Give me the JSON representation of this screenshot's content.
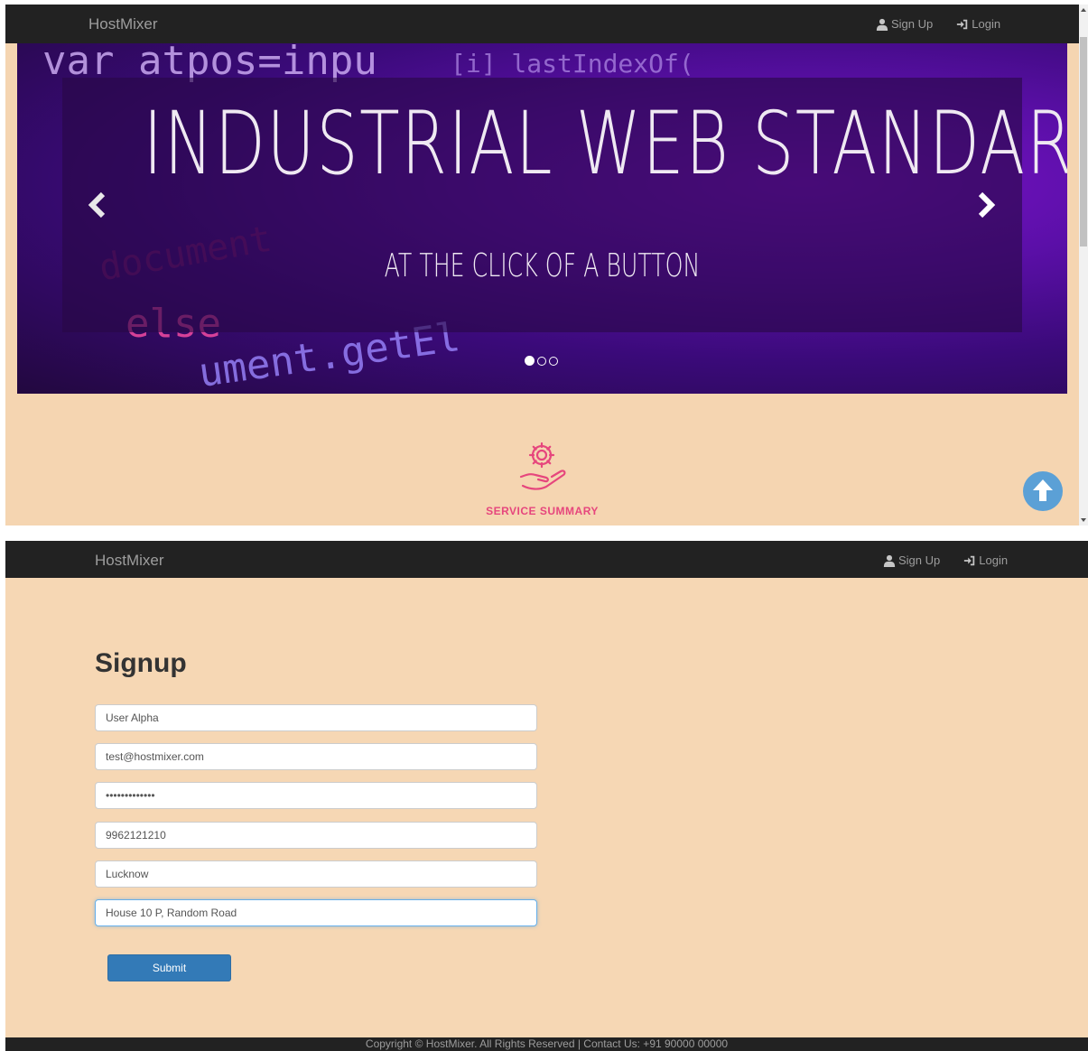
{
  "brand": "HostMixer",
  "nav": {
    "signup": "Sign Up",
    "login": "Login",
    "signup_icon": "user-icon",
    "login_icon": "login-icon"
  },
  "hero": {
    "headline": "INDUSTRIAL WEB STANDARDS",
    "subline": "AT THE CLICK OF A BUTTON",
    "background_code": [
      "var atpos=inpu",
      "[i] lastIndexOf(",
      "else",
      "ument.getEl",
      "document"
    ],
    "slide_count": 3,
    "active_slide": 1
  },
  "service": {
    "label": "SERVICE SUMMARY",
    "icon": "hand-gear-icon"
  },
  "back_to_top_icon": "arrow-up-icon",
  "signup_form": {
    "title": "Signup",
    "fields": [
      {
        "value": "User Alpha"
      },
      {
        "value": "test@hostmixer.com"
      },
      {
        "value": "•••••••••••••"
      },
      {
        "value": "9962121210"
      },
      {
        "value": "Lucknow"
      },
      {
        "value": "House 10 P, Random Road"
      }
    ],
    "submit_label": "Submit"
  },
  "footer": {
    "text": "Copyright © HostMixer. All Rights Reserved | Contact Us: +91 90000 00000"
  },
  "colors": {
    "navbar": "#222222",
    "page_background": "#f5d5b1",
    "accent_pink": "#e6467d",
    "primary_button": "#337ab7",
    "back_to_top": "#5ba0d6"
  }
}
